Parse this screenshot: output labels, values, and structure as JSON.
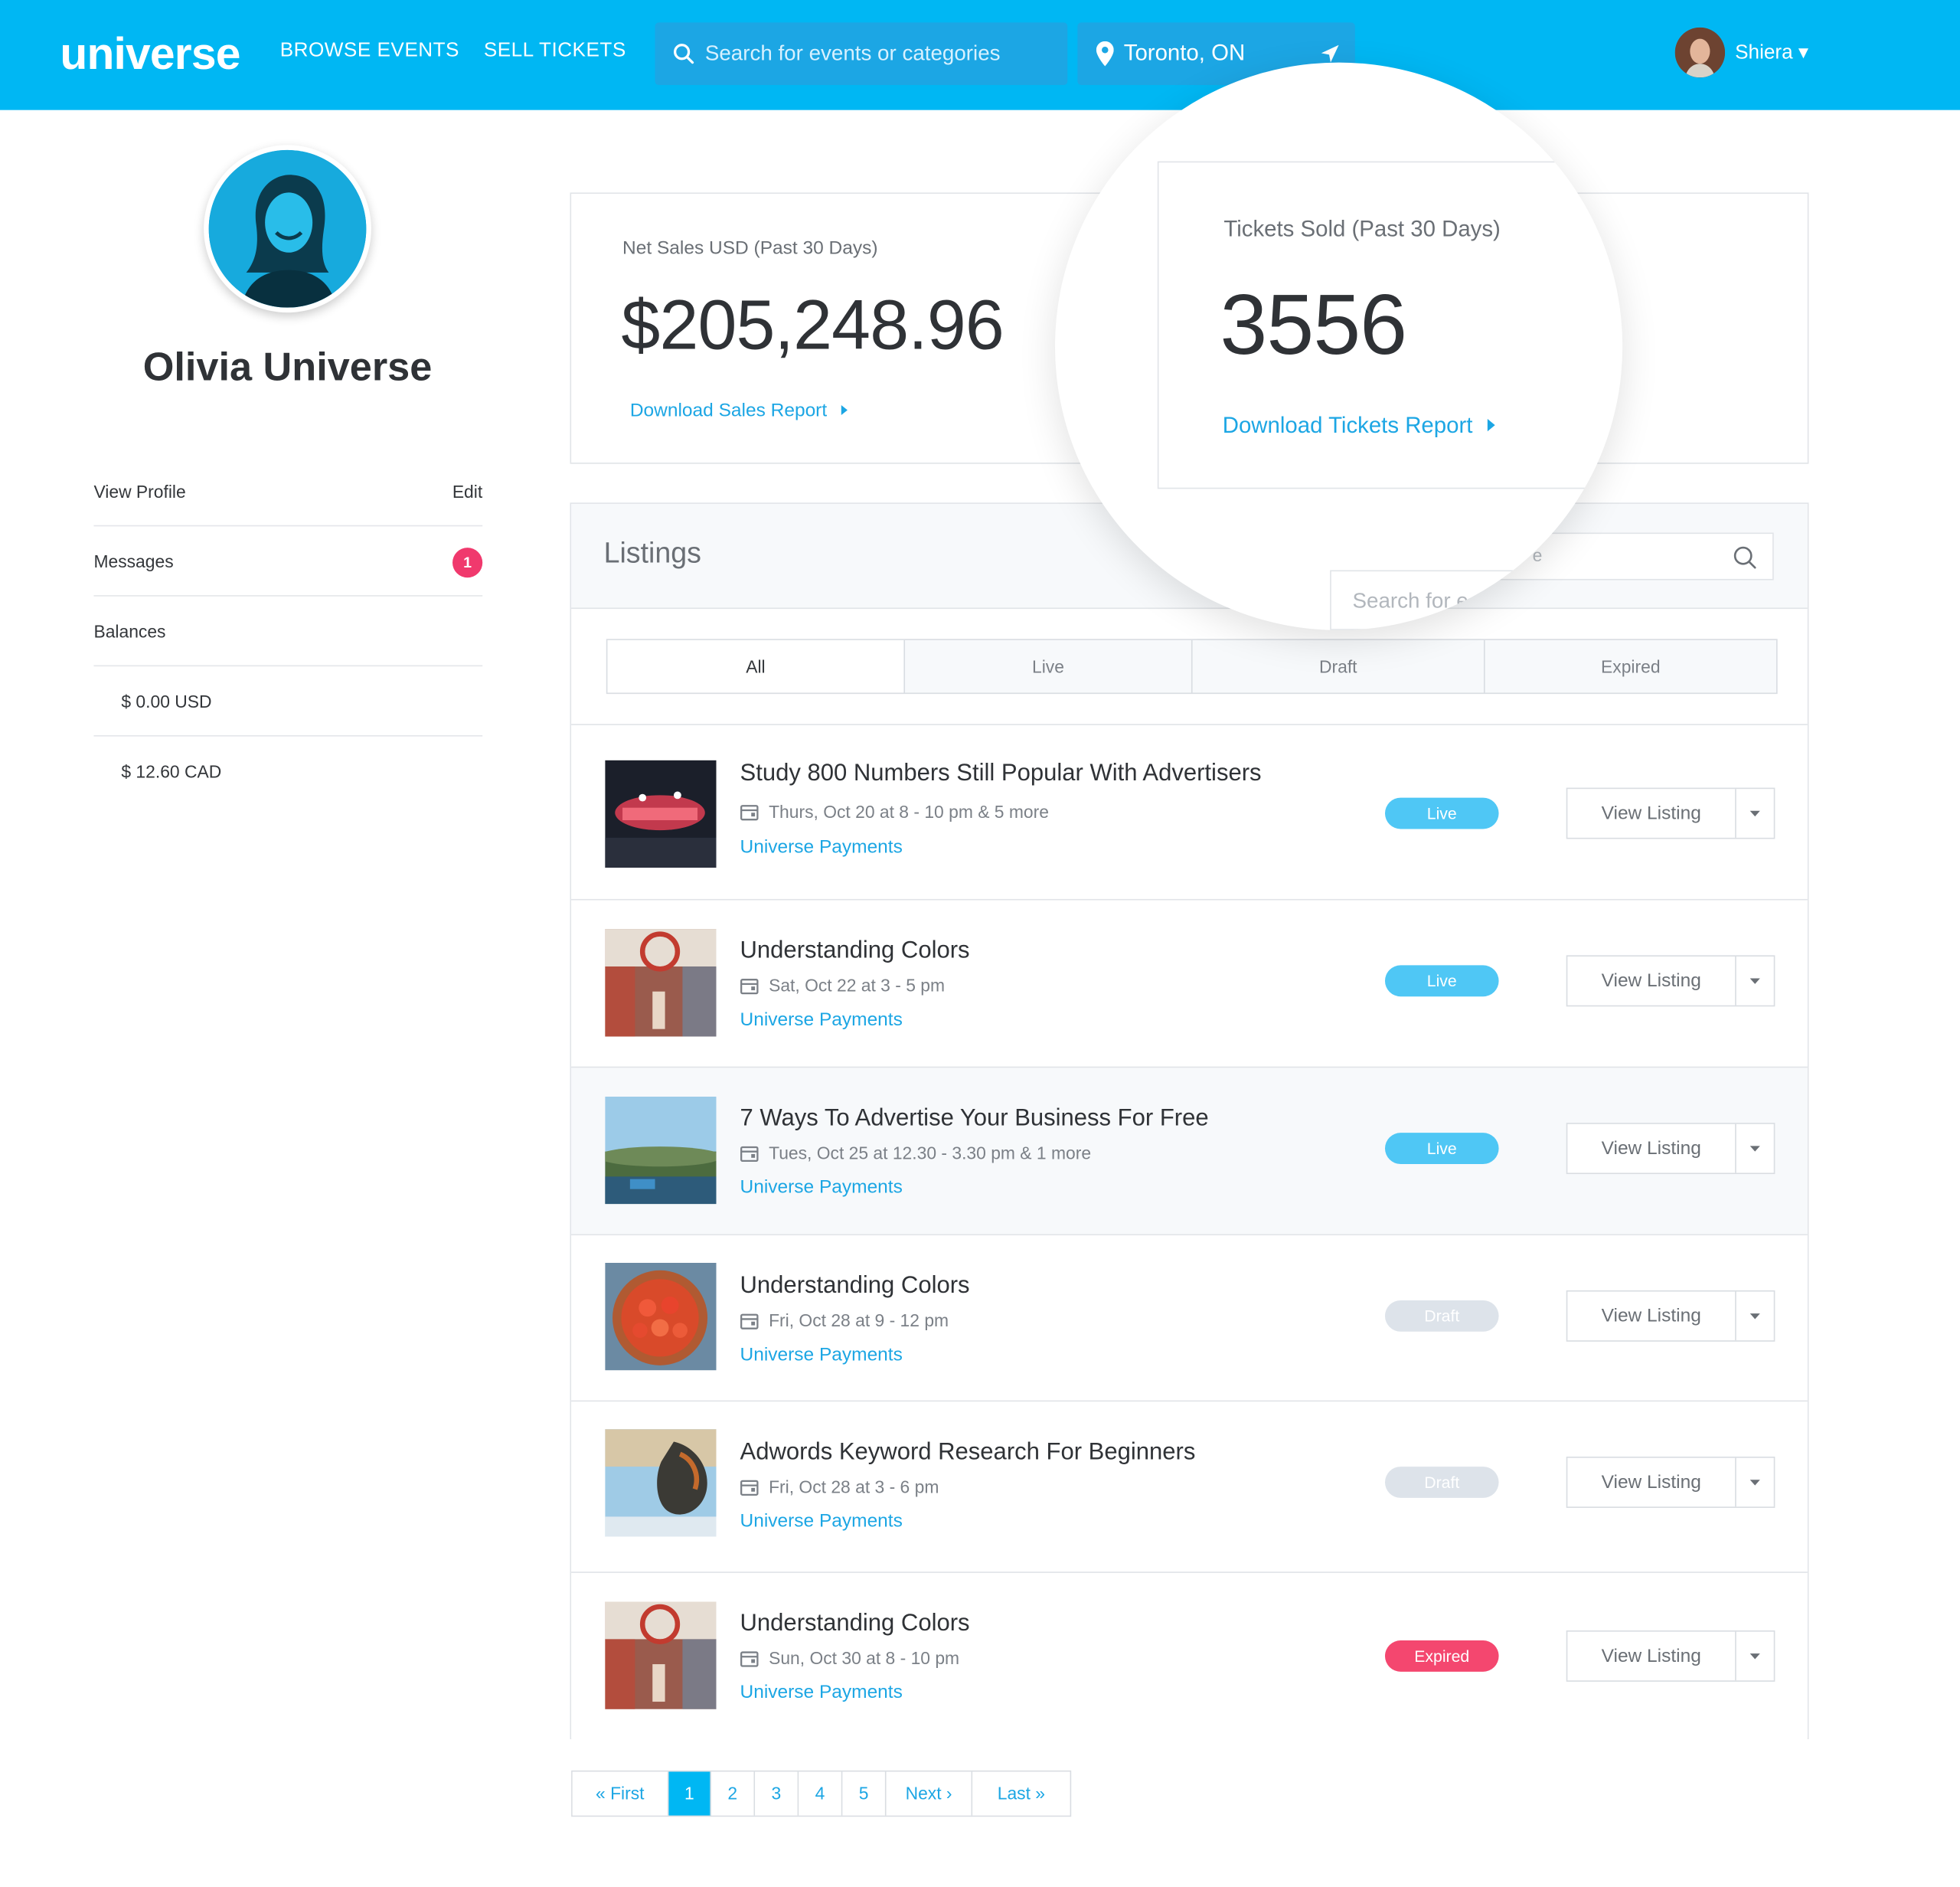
{
  "header": {
    "logo": "universe",
    "nav": [
      "BROWSE EVENTS",
      "SELL TICKETS"
    ],
    "search_placeholder": "Search for events or categories",
    "location": "Toronto, ON",
    "user_name": "Shiera ▾"
  },
  "profile": {
    "name": "Olivia Universe",
    "menu": {
      "view_profile": "View Profile",
      "edit": "Edit",
      "messages": "Messages",
      "messages_count": "1",
      "balances": "Balances",
      "balance_usd": "$ 0.00 USD",
      "balance_cad": "$ 12.60 CAD"
    }
  },
  "stats": {
    "sales_label": "Net Sales USD (Past 30 Days)",
    "sales_value": "$205,248.96",
    "sales_link": "Download Sales Report",
    "tickets_label": "Tickets Sold (Past 30 Days)",
    "tickets_value": "3556",
    "tickets_link": "Download Tickets Report"
  },
  "listings": {
    "title": "Listings",
    "search_placeholder": "Search for e",
    "search_fragment": "e",
    "tabs": [
      "All",
      "Live",
      "Draft",
      "Expired"
    ],
    "view_label": "View Listing",
    "items": [
      {
        "title": "Study 800 Numbers Still Popular With Advertisers",
        "date": "Thurs, Oct 20 at 8 - 10 pm & 5 more",
        "org": "Universe Payments",
        "status": "Live"
      },
      {
        "title": "Understanding Colors",
        "date": "Sat, Oct 22 at 3 - 5 pm",
        "org": "Universe Payments",
        "status": "Live"
      },
      {
        "title": "7 Ways To Advertise Your Business For Free",
        "date": "Tues, Oct 25 at 12.30 - 3.30 pm & 1 more",
        "org": "Universe Payments",
        "status": "Live"
      },
      {
        "title": "Understanding Colors",
        "date": "Fri, Oct 28 at 9 - 12 pm",
        "org": "Universe Payments",
        "status": "Draft"
      },
      {
        "title": "Adwords Keyword Research For Beginners",
        "date": "Fri, Oct 28 at 3 - 6 pm",
        "org": "Universe Payments",
        "status": "Draft"
      },
      {
        "title": "Understanding Colors",
        "date": "Sun, Oct 30 at 8 - 10 pm",
        "org": "Universe Payments",
        "status": "Expired"
      }
    ]
  },
  "pagination": {
    "first": "« First",
    "pages": [
      "1",
      "2",
      "3",
      "4",
      "5"
    ],
    "next": "Next ›",
    "last": "Last »",
    "current": "1"
  },
  "colors": {
    "brand": "#00b7f3",
    "link": "#1ca6e4",
    "live": "#4fc7f5",
    "draft": "#dde3ea",
    "expired": "#f4476f"
  }
}
